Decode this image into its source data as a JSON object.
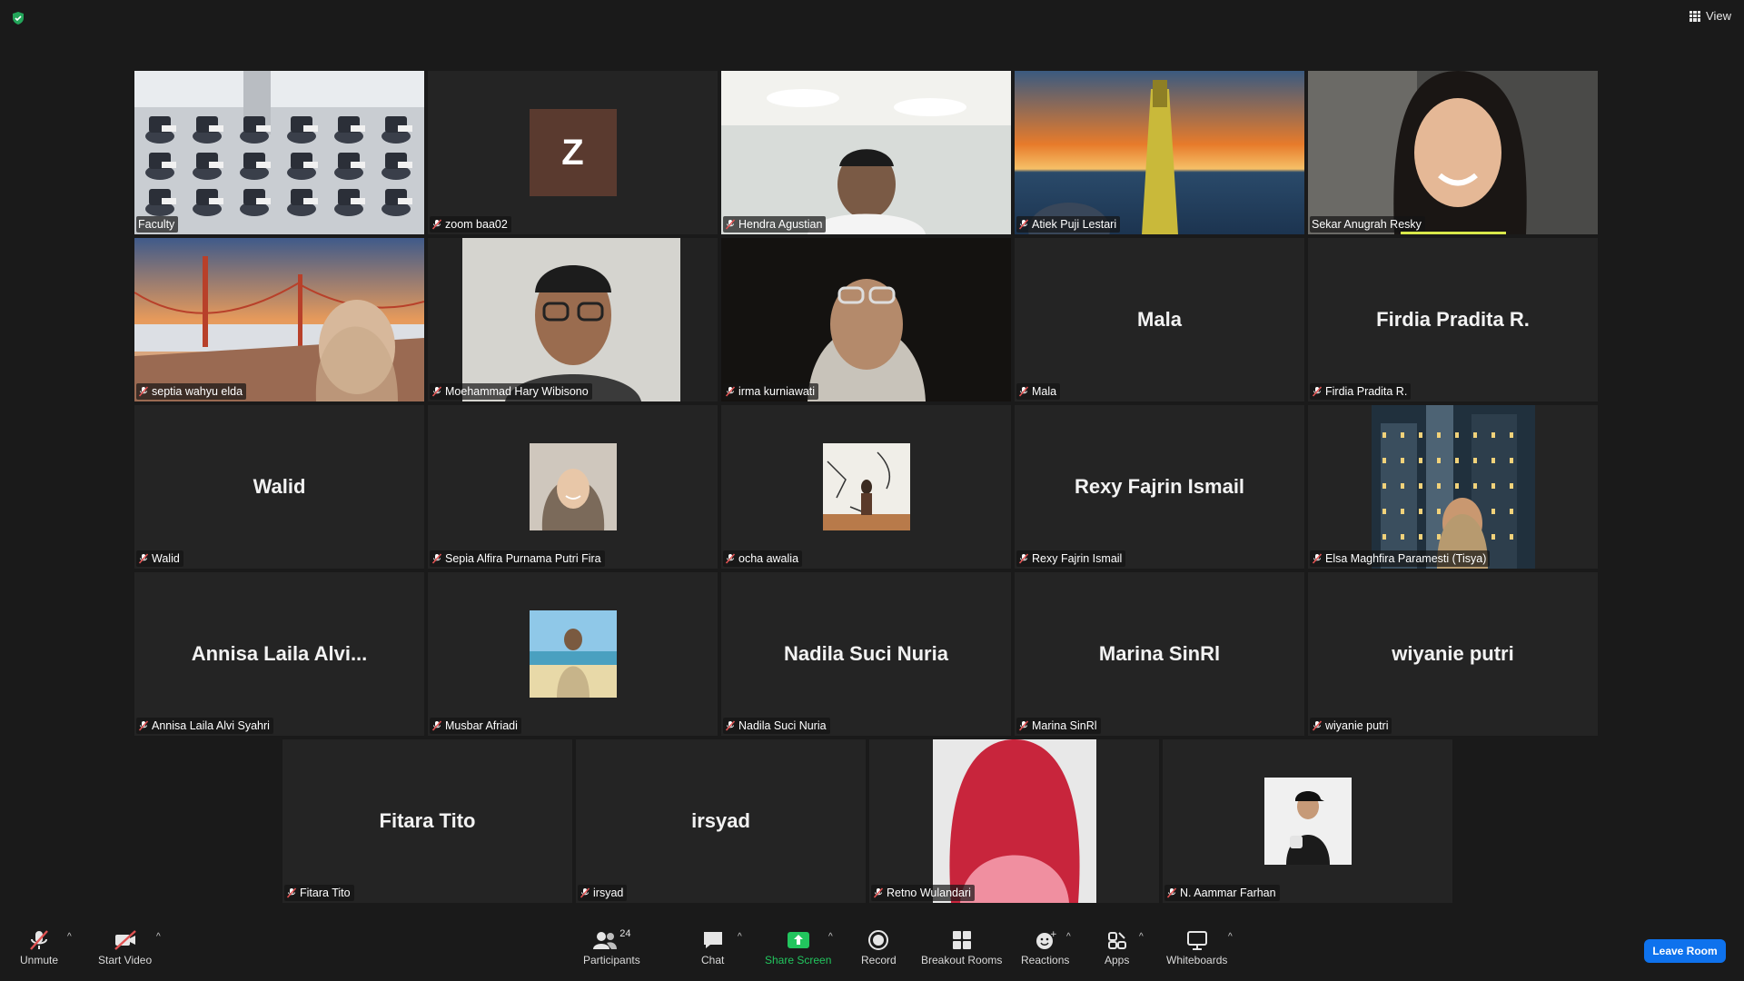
{
  "window": {
    "view_label": "View"
  },
  "colors": {
    "accent_active": "#c8d84a",
    "leave": "#0e72ed",
    "share": "#22c55e",
    "mute": "#e05252"
  },
  "rows": [
    [
      {
        "label": "Faculty",
        "type": "video",
        "muted": false,
        "active": true,
        "scene": "classroom"
      },
      {
        "label": "zoom baa02",
        "type": "letter",
        "letter": "Z",
        "muted": true
      },
      {
        "label": "Hendra Agustian",
        "type": "video",
        "muted": true,
        "scene": "office"
      },
      {
        "label": "Atiek Puji Lestari",
        "type": "video",
        "muted": true,
        "scene": "sunset"
      },
      {
        "label": "Sekar Anugrah Resky",
        "type": "video",
        "muted": false,
        "speaking": true,
        "scene": "person"
      }
    ],
    [
      {
        "label": "septia wahyu elda",
        "type": "video",
        "muted": true,
        "scene": "bridge"
      },
      {
        "label": "Moehammad Hary Wibisono",
        "type": "video",
        "muted": true,
        "scene": "person-glasses"
      },
      {
        "label": "irma kurniawati",
        "type": "video",
        "muted": true,
        "scene": "dark-person"
      },
      {
        "label": "Mala",
        "big": "Mala",
        "type": "name",
        "muted": true
      },
      {
        "label": "Firdia Pradita R.",
        "big": "Firdia Pradita R.",
        "type": "name",
        "muted": true
      }
    ],
    [
      {
        "label": "Walid",
        "big": "Walid",
        "type": "name",
        "muted": true
      },
      {
        "label": "Sepia Alfira Purnama Putri Fira",
        "type": "photo",
        "muted": true,
        "scene": "hijab"
      },
      {
        "label": "ocha awalia",
        "type": "photo",
        "muted": true,
        "scene": "mural"
      },
      {
        "label": "Rexy Fajrin Ismail",
        "big": "Rexy Fajrin Ismail",
        "type": "name",
        "muted": true
      },
      {
        "label": "Elsa Maghfira Paramesti (Tisya)",
        "type": "video-center",
        "muted": true,
        "scene": "city"
      }
    ],
    [
      {
        "label": "Annisa Laila Alvi Syahri",
        "big": "Annisa  Laila  Alvi...",
        "type": "name",
        "muted": true
      },
      {
        "label": "Musbar Afriadi",
        "type": "photo",
        "muted": true,
        "scene": "beach"
      },
      {
        "label": "Nadila Suci Nuria",
        "big": "Nadila Suci Nuria",
        "type": "name",
        "muted": true
      },
      {
        "label": "Marina SinRl",
        "big": "Marina SinRl",
        "type": "name",
        "muted": true
      },
      {
        "label": "wiyanie putri",
        "big": "wiyanie putri",
        "type": "name",
        "muted": true
      }
    ],
    [
      {
        "label": "Fitara Tito",
        "big": "Fitara Tito",
        "type": "name",
        "muted": true
      },
      {
        "label": "irsyad",
        "big": "irsyad",
        "type": "name",
        "muted": true
      },
      {
        "label": "Retno Wulandari",
        "type": "video-center",
        "muted": true,
        "scene": "redhair"
      },
      {
        "label": "N. Aammar Farhan",
        "type": "photo",
        "muted": true,
        "scene": "cap"
      }
    ]
  ],
  "toolbar": {
    "unmute": "Unmute",
    "start_video": "Start Video",
    "participants": "Participants",
    "participants_count": "24",
    "chat": "Chat",
    "share_screen": "Share Screen",
    "record": "Record",
    "breakout_rooms": "Breakout Rooms",
    "reactions": "Reactions",
    "apps": "Apps",
    "whiteboards": "Whiteboards",
    "leave_room": "Leave Room"
  }
}
